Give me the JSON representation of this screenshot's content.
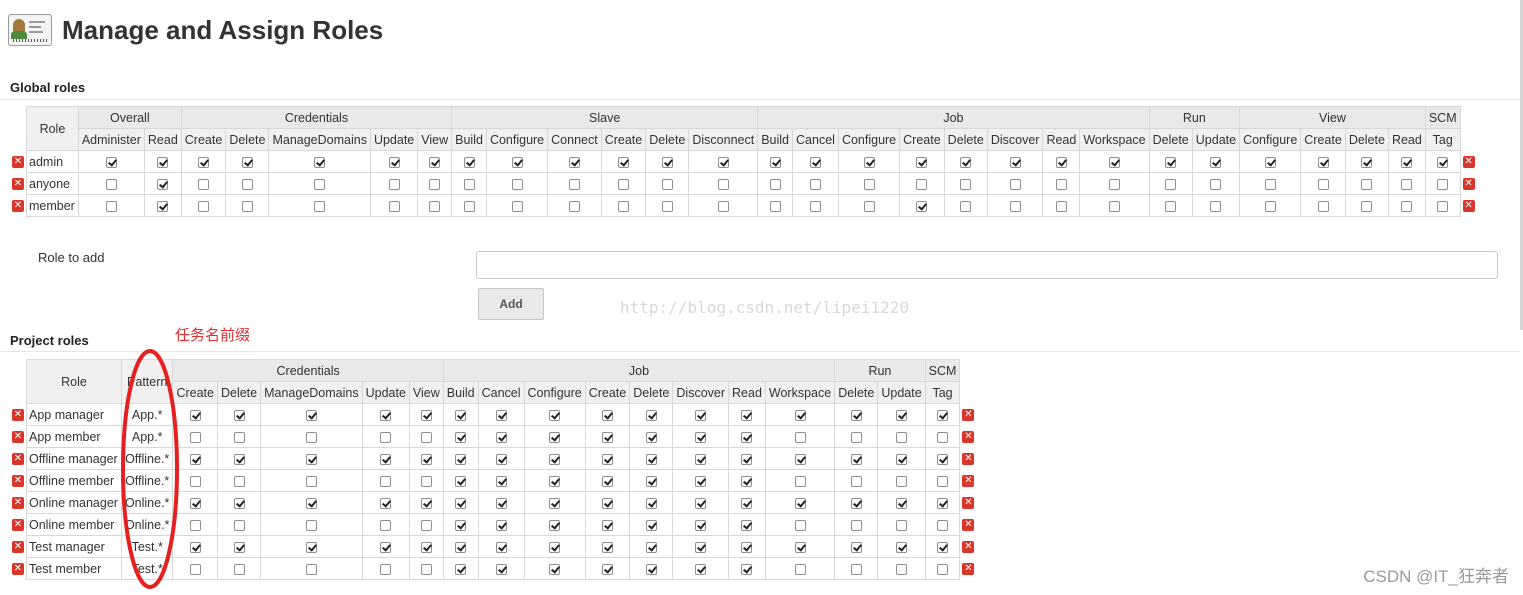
{
  "page": {
    "title": "Manage and Assign Roles",
    "icon": "user-card-icon"
  },
  "global": {
    "section_title": "Global roles",
    "role_header": "Role",
    "groups": [
      {
        "name": "Overall",
        "perms": [
          "Administer",
          "Read"
        ]
      },
      {
        "name": "Credentials",
        "perms": [
          "Create",
          "Delete",
          "ManageDomains",
          "Update",
          "View"
        ]
      },
      {
        "name": "Slave",
        "perms": [
          "Build",
          "Configure",
          "Connect",
          "Create",
          "Delete",
          "Disconnect"
        ]
      },
      {
        "name": "Job",
        "perms": [
          "Build",
          "Cancel",
          "Configure",
          "Create",
          "Delete",
          "Discover",
          "Read",
          "Workspace"
        ]
      },
      {
        "name": "Run",
        "perms": [
          "Delete",
          "Update"
        ]
      },
      {
        "name": "View",
        "perms": [
          "Configure",
          "Create",
          "Delete",
          "Read"
        ]
      },
      {
        "name": "SCM",
        "perms": [
          "Tag"
        ]
      }
    ],
    "rows": [
      {
        "name": "admin",
        "checks": [
          1,
          1,
          1,
          1,
          1,
          1,
          1,
          1,
          1,
          1,
          1,
          1,
          1,
          1,
          1,
          1,
          1,
          1,
          1,
          1,
          1,
          1,
          1,
          1,
          1,
          1,
          1,
          1
        ]
      },
      {
        "name": "anyone",
        "checks": [
          0,
          1,
          0,
          0,
          0,
          0,
          0,
          0,
          0,
          0,
          0,
          0,
          0,
          0,
          0,
          0,
          0,
          0,
          0,
          0,
          0,
          0,
          0,
          0,
          0,
          0,
          0,
          0
        ]
      },
      {
        "name": "member",
        "checks": [
          0,
          1,
          0,
          0,
          0,
          0,
          0,
          0,
          0,
          0,
          0,
          0,
          0,
          0,
          0,
          0,
          1,
          0,
          0,
          0,
          0,
          0,
          0,
          0,
          0,
          0,
          0,
          0
        ]
      }
    ]
  },
  "role_to_add": {
    "label": "Role to add",
    "value": "",
    "button_label": "Add"
  },
  "project": {
    "section_title": "Project roles",
    "role_header": "Role",
    "pattern_header": "Pattern",
    "groups": [
      {
        "name": "Credentials",
        "perms": [
          "Create",
          "Delete",
          "ManageDomains",
          "Update",
          "View"
        ]
      },
      {
        "name": "Job",
        "perms": [
          "Build",
          "Cancel",
          "Configure",
          "Create",
          "Delete",
          "Discover",
          "Read",
          "Workspace"
        ]
      },
      {
        "name": "Run",
        "perms": [
          "Delete",
          "Update"
        ]
      },
      {
        "name": "SCM",
        "perms": [
          "Tag"
        ]
      }
    ],
    "rows": [
      {
        "name": "App manager",
        "pattern": "App.*",
        "checks": [
          1,
          1,
          1,
          1,
          1,
          1,
          1,
          1,
          1,
          1,
          1,
          1,
          1,
          1,
          1,
          1
        ]
      },
      {
        "name": "App member",
        "pattern": "App.*",
        "checks": [
          0,
          0,
          0,
          0,
          0,
          1,
          1,
          1,
          1,
          1,
          1,
          1,
          0,
          0,
          0,
          0
        ]
      },
      {
        "name": "Offline manager",
        "pattern": "Offline.*",
        "checks": [
          1,
          1,
          1,
          1,
          1,
          1,
          1,
          1,
          1,
          1,
          1,
          1,
          1,
          1,
          1,
          1
        ]
      },
      {
        "name": "Offline member",
        "pattern": "Offline.*",
        "checks": [
          0,
          0,
          0,
          0,
          0,
          1,
          1,
          1,
          1,
          1,
          1,
          1,
          0,
          0,
          0,
          0
        ]
      },
      {
        "name": "Online manager",
        "pattern": "Online.*",
        "checks": [
          1,
          1,
          1,
          1,
          1,
          1,
          1,
          1,
          1,
          1,
          1,
          1,
          1,
          1,
          1,
          1
        ]
      },
      {
        "name": "Online member",
        "pattern": "Online.*",
        "checks": [
          0,
          0,
          0,
          0,
          0,
          1,
          1,
          1,
          1,
          1,
          1,
          1,
          0,
          0,
          0,
          0
        ]
      },
      {
        "name": "Test manager",
        "pattern": "Test.*",
        "checks": [
          1,
          1,
          1,
          1,
          1,
          1,
          1,
          1,
          1,
          1,
          1,
          1,
          1,
          1,
          1,
          1
        ]
      },
      {
        "name": "Test member",
        "pattern": "Test.*",
        "checks": [
          0,
          0,
          0,
          0,
          0,
          1,
          1,
          1,
          1,
          1,
          1,
          1,
          0,
          0,
          0,
          0
        ]
      }
    ]
  },
  "annotation": {
    "text": "任务名前缀",
    "color": "#e23030"
  },
  "watermark": "http://blog.csdn.net/lipei1220",
  "corner_mark": "CSDN @IT_狂奔者",
  "colors": {
    "delete_icon": "#d9362b",
    "header_bg": "#f0f0f0"
  }
}
